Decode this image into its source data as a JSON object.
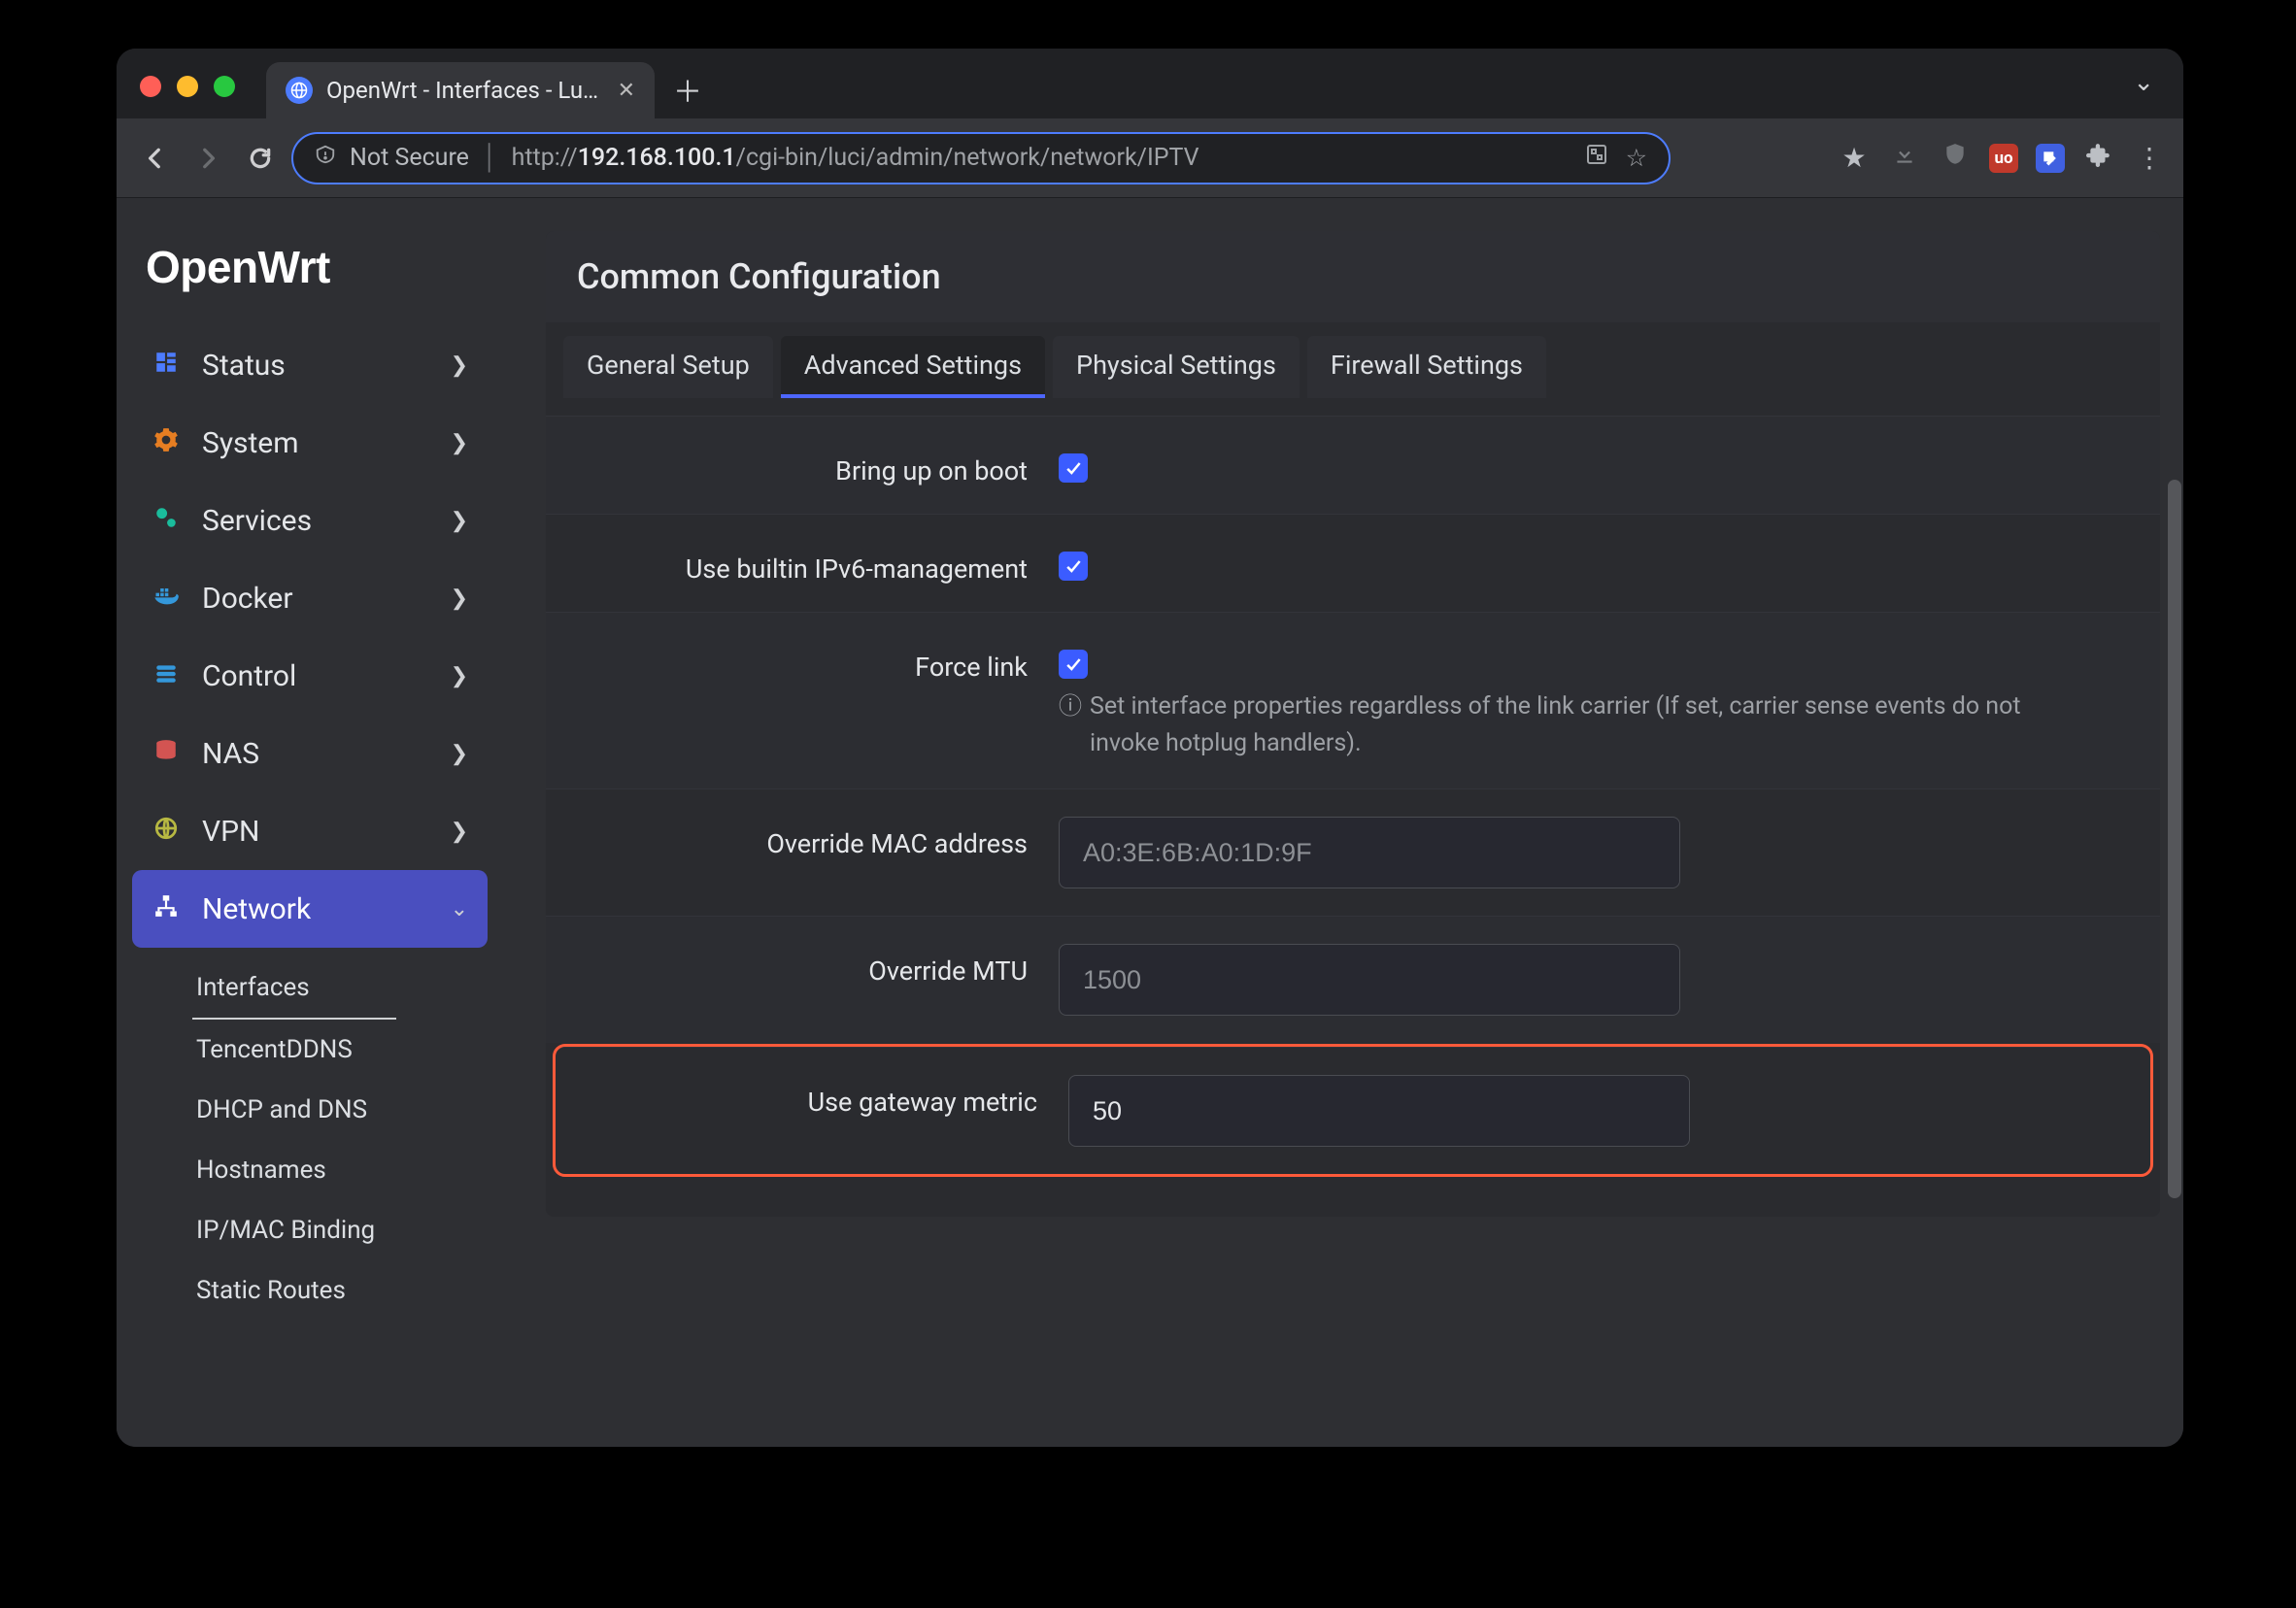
{
  "browser": {
    "tab_title": "OpenWrt - Interfaces - LuCI",
    "url_prefix": "http://",
    "url_host": "192.168.100.1",
    "url_path": "/cgi-bin/luci/admin/network/network/IPTV",
    "secure_label": "Not Secure"
  },
  "sidebar": {
    "logo": "OpenWrt",
    "items": [
      {
        "label": "Status",
        "icon": "status"
      },
      {
        "label": "System",
        "icon": "system"
      },
      {
        "label": "Services",
        "icon": "services"
      },
      {
        "label": "Docker",
        "icon": "docker"
      },
      {
        "label": "Control",
        "icon": "control"
      },
      {
        "label": "NAS",
        "icon": "nas"
      },
      {
        "label": "VPN",
        "icon": "vpn"
      },
      {
        "label": "Network",
        "icon": "network"
      }
    ],
    "subitems": [
      "Interfaces",
      "TencentDDNS",
      "DHCP and DNS",
      "Hostnames",
      "IP/MAC Binding",
      "Static Routes"
    ]
  },
  "panel": {
    "title": "Common Configuration",
    "tabs": [
      "General Setup",
      "Advanced Settings",
      "Physical Settings",
      "Firewall Settings"
    ]
  },
  "fields": {
    "bring_up": {
      "label": "Bring up on boot",
      "checked": true
    },
    "ipv6": {
      "label": "Use builtin IPv6-management",
      "checked": true
    },
    "force_link": {
      "label": "Force link",
      "checked": true,
      "hint": "Set interface properties regardless of the link carrier (If set, carrier sense events do not invoke hotplug handlers)."
    },
    "mac": {
      "label": "Override MAC address",
      "placeholder": "A0:3E:6B:A0:1D:9F",
      "value": ""
    },
    "mtu": {
      "label": "Override MTU",
      "placeholder": "1500",
      "value": ""
    },
    "metric": {
      "label": "Use gateway metric",
      "value": "50"
    }
  }
}
